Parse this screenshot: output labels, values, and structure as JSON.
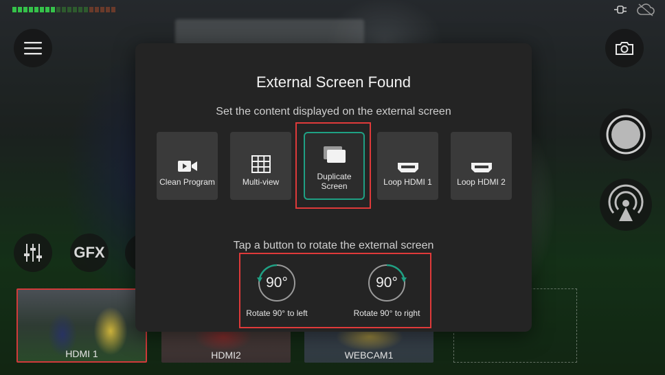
{
  "modal": {
    "title": "External Screen Found",
    "subtitle": "Set the content displayed on the external screen",
    "options": [
      {
        "label": "Clean Program",
        "icon": "video-camera-icon",
        "selected": false
      },
      {
        "label": "Multi-view",
        "icon": "grid-icon",
        "selected": false
      },
      {
        "label": "Duplicate Screen",
        "icon": "duplicate-screen-icon",
        "selected": true
      },
      {
        "label": "Loop HDMI 1",
        "icon": "hdmi-icon",
        "selected": false
      },
      {
        "label": "Loop HDMI 2",
        "icon": "hdmi-icon",
        "selected": false
      }
    ],
    "rotate_label": "Tap a button to rotate the external screen",
    "rotate_left": {
      "degrees": "90°",
      "label": "Rotate 90° to left"
    },
    "rotate_right": {
      "degrees": "90°",
      "label": "Rotate 90° to right"
    }
  },
  "controls": {
    "gfx_label": "GFX"
  },
  "sources": [
    {
      "label": "HDMI 1",
      "active": true
    },
    {
      "label": "HDMI2",
      "active": false
    },
    {
      "label": "WEBCAM1",
      "active": false
    }
  ],
  "colors": {
    "accent": "#1fa184",
    "active_source": "#d23a3a",
    "highlight": "#e03a3a",
    "modal_bg": "#242424",
    "tile_bg": "#3a3a3a"
  }
}
